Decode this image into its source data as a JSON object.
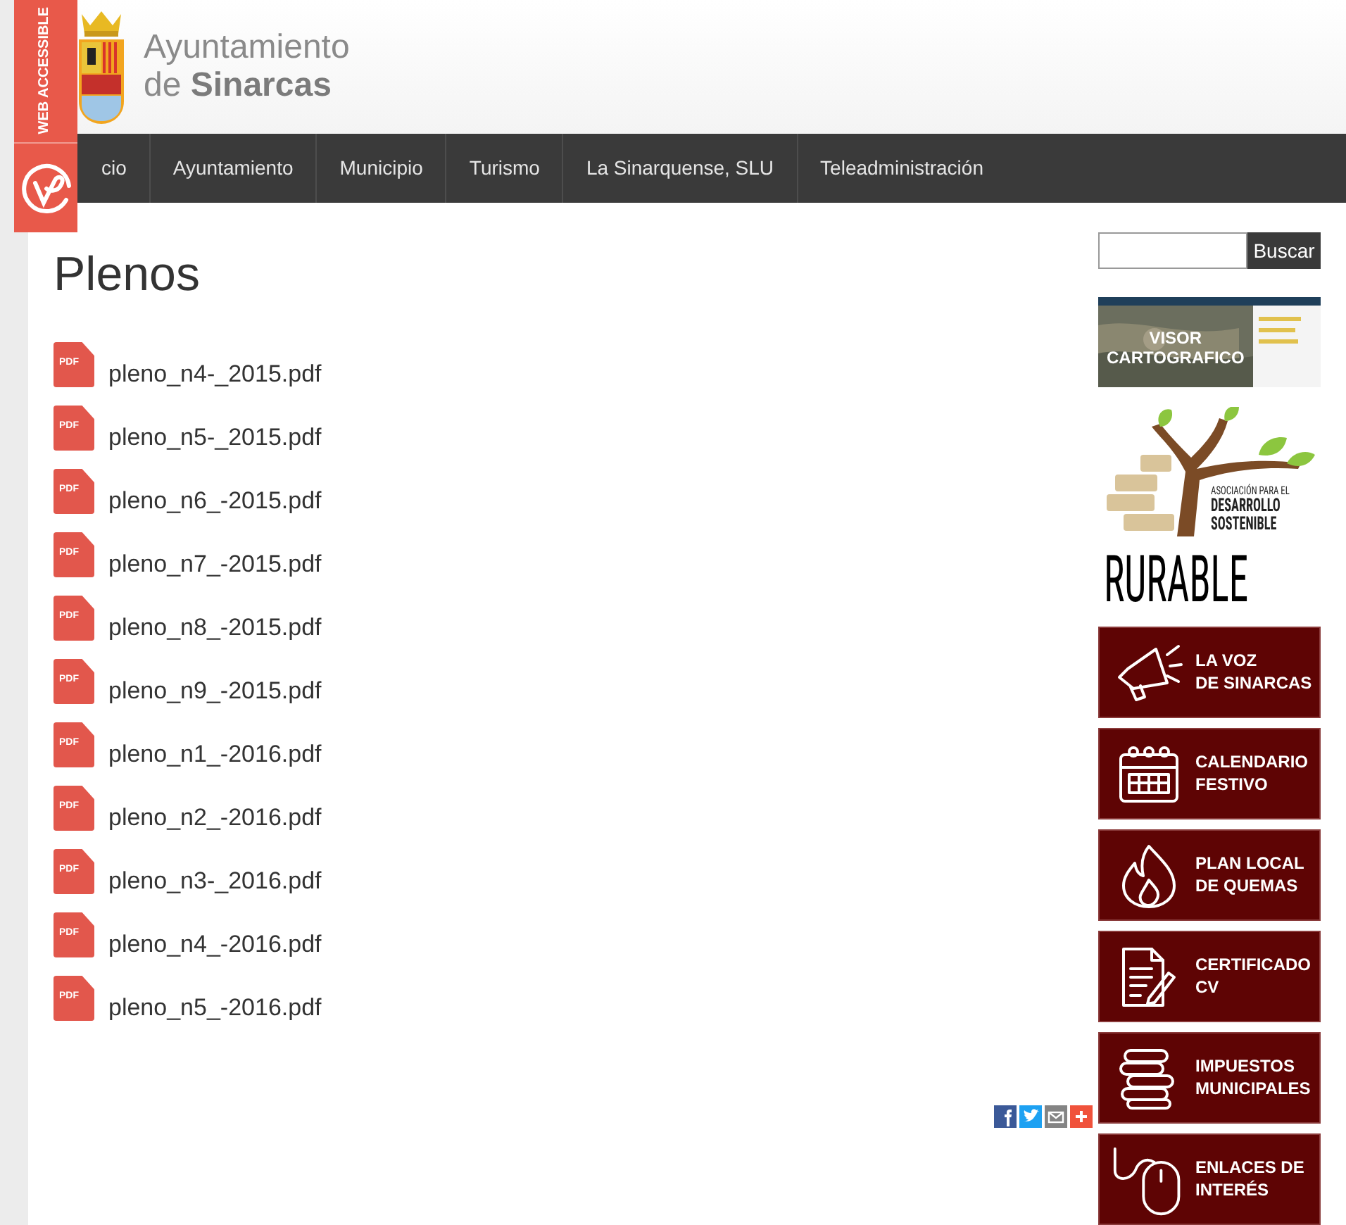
{
  "accessibility_badge": {
    "label": "WEB ACCESSIBLE"
  },
  "header": {
    "title_line1": "Ayuntamiento",
    "title_line2_prefix": "de",
    "title_line2_bold": "Sinarcas"
  },
  "nav": {
    "items": [
      {
        "label": "cio"
      },
      {
        "label": "Ayuntamiento"
      },
      {
        "label": "Municipio"
      },
      {
        "label": "Turismo"
      },
      {
        "label": "La Sinarquense, SLU"
      },
      {
        "label": "Teleadministración"
      }
    ]
  },
  "page": {
    "title": "Plenos",
    "files": [
      {
        "badge": "PDF",
        "name": "pleno_n4-_2015.pdf"
      },
      {
        "badge": "PDF",
        "name": "pleno_n5-_2015.pdf"
      },
      {
        "badge": "PDF",
        "name": "pleno_n6_-2015.pdf"
      },
      {
        "badge": "PDF",
        "name": "pleno_n7_-2015.pdf"
      },
      {
        "badge": "PDF",
        "name": "pleno_n8_-2015.pdf"
      },
      {
        "badge": "PDF",
        "name": "pleno_n9_-2015.pdf"
      },
      {
        "badge": "PDF",
        "name": "pleno_n1_-2016.pdf"
      },
      {
        "badge": "PDF",
        "name": "pleno_n2_-2016.pdf"
      },
      {
        "badge": "PDF",
        "name": "pleno_n3-_2016.pdf"
      },
      {
        "badge": "PDF",
        "name": "pleno_n4_-2016.pdf"
      },
      {
        "badge": "PDF",
        "name": "pleno_n5_-2016.pdf"
      }
    ],
    "share": [
      {
        "kind": "facebook",
        "color": "#3b5998"
      },
      {
        "kind": "twitter",
        "color": "#1da1f2"
      },
      {
        "kind": "email",
        "color": "#848484"
      },
      {
        "kind": "more",
        "color": "#f0523b"
      }
    ]
  },
  "sidebar": {
    "search_button": "Buscar",
    "map_banner": {
      "line1": "VISOR",
      "line2": "CARTOGRAFICO"
    },
    "rurable": {
      "line1": "ASOCIACIÓN PARA EL",
      "line2": "DESARROLLO",
      "line3": "SOSTENIBLE",
      "name": "RURABLE"
    },
    "banners": [
      {
        "kind": "megaphone",
        "line1": "LA VOZ",
        "line2": "DE SINARCAS"
      },
      {
        "kind": "calendar",
        "line1": "CALENDARIO",
        "line2": "FESTIVO"
      },
      {
        "kind": "fire",
        "line1": "PLAN LOCAL",
        "line2": "DE QUEMAS"
      },
      {
        "kind": "certificate",
        "line1": "CERTIFICADO",
        "line2": "CV"
      },
      {
        "kind": "coins",
        "line1": "IMPUESTOS",
        "line2": "MUNICIPALES"
      },
      {
        "kind": "mouse",
        "line1": "ENLACES DE",
        "line2": "INTERÉS"
      }
    ]
  }
}
